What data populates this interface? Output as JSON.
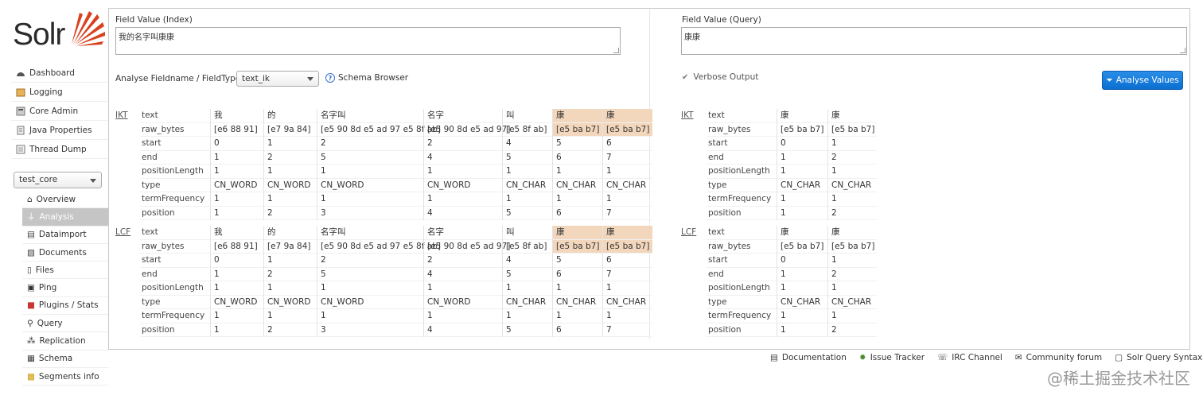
{
  "logo": {
    "text": "Solr"
  },
  "nav": [
    {
      "label": "Dashboard",
      "icon": "dashboard-icon"
    },
    {
      "label": "Logging",
      "icon": "logging-icon"
    },
    {
      "label": "Core Admin",
      "icon": "core-admin-icon"
    },
    {
      "label": "Java Properties",
      "icon": "java-properties-icon"
    },
    {
      "label": "Thread Dump",
      "icon": "thread-dump-icon"
    }
  ],
  "core_selector": {
    "value": "test_core"
  },
  "core_nav": [
    {
      "label": "Overview",
      "icon": "home-icon"
    },
    {
      "label": "Analysis",
      "icon": "filter-icon",
      "active": true
    },
    {
      "label": "Dataimport",
      "icon": "dataimport-icon"
    },
    {
      "label": "Documents",
      "icon": "documents-icon"
    },
    {
      "label": "Files",
      "icon": "files-icon"
    },
    {
      "label": "Ping",
      "icon": "ping-icon"
    },
    {
      "label": "Plugins / Stats",
      "icon": "plugins-icon"
    },
    {
      "label": "Query",
      "icon": "query-icon"
    },
    {
      "label": "Replication",
      "icon": "replication-icon"
    },
    {
      "label": "Schema",
      "icon": "schema-icon"
    },
    {
      "label": "Segments info",
      "icon": "segments-icon"
    }
  ],
  "analysis": {
    "index_label": "Field Value (Index)",
    "index_value": "我的名字叫康康",
    "query_label": "Field Value (Query)",
    "query_value": "康康",
    "fieldtype_label": "Analyse Fieldname / FieldType:",
    "fieldtype_value": "text_ik",
    "schema_browser": "Schema Browser",
    "verbose_label": "Verbose Output",
    "analyse_button": "Analyse Values"
  },
  "attributes": [
    "text",
    "raw_bytes",
    "start",
    "end",
    "positionLength",
    "type",
    "termFrequency",
    "position"
  ],
  "index_blocks": [
    {
      "label": "IKT",
      "tokens": [
        {
          "vals": [
            "我",
            "[e6 88 91]",
            "0",
            "1",
            "1",
            "CN_WORD",
            "1",
            "1"
          ]
        },
        {
          "vals": [
            "的",
            "[e7 9a 84]",
            "1",
            "2",
            "1",
            "CN_WORD",
            "1",
            "2"
          ]
        },
        {
          "vals": [
            "名字叫",
            "[e5 90 8d e5 ad 97 e5 8f ab]",
            "2",
            "5",
            "1",
            "CN_WORD",
            "1",
            "3"
          ]
        },
        {
          "vals": [
            "名字",
            "[e5 90 8d e5 ad 97]",
            "2",
            "4",
            "1",
            "CN_WORD",
            "1",
            "4"
          ]
        },
        {
          "vals": [
            "叫",
            "[e5 8f ab]",
            "4",
            "5",
            "1",
            "CN_CHAR",
            "1",
            "5"
          ]
        },
        {
          "vals": [
            "康",
            "[e5 ba b7]",
            "5",
            "6",
            "1",
            "CN_CHAR",
            "1",
            "6"
          ],
          "match": true
        },
        {
          "vals": [
            "康",
            "[e5 ba b7]",
            "6",
            "7",
            "1",
            "CN_CHAR",
            "1",
            "7"
          ],
          "match": true
        }
      ]
    },
    {
      "label": "LCF",
      "tokens": [
        {
          "vals": [
            "我",
            "[e6 88 91]",
            "0",
            "1",
            "1",
            "CN_WORD",
            "1",
            "1"
          ]
        },
        {
          "vals": [
            "的",
            "[e7 9a 84]",
            "1",
            "2",
            "1",
            "CN_WORD",
            "1",
            "2"
          ]
        },
        {
          "vals": [
            "名字叫",
            "[e5 90 8d e5 ad 97 e5 8f ab]",
            "2",
            "5",
            "1",
            "CN_WORD",
            "1",
            "3"
          ]
        },
        {
          "vals": [
            "名字",
            "[e5 90 8d e5 ad 97]",
            "2",
            "4",
            "1",
            "CN_WORD",
            "1",
            "4"
          ]
        },
        {
          "vals": [
            "叫",
            "[e5 8f ab]",
            "4",
            "5",
            "1",
            "CN_CHAR",
            "1",
            "5"
          ]
        },
        {
          "vals": [
            "康",
            "[e5 ba b7]",
            "5",
            "6",
            "1",
            "CN_CHAR",
            "1",
            "6"
          ],
          "match": true
        },
        {
          "vals": [
            "康",
            "[e5 ba b7]",
            "6",
            "7",
            "1",
            "CN_CHAR",
            "1",
            "7"
          ],
          "match": true
        }
      ]
    }
  ],
  "query_blocks": [
    {
      "label": "IKT",
      "tokens": [
        {
          "vals": [
            "康",
            "[e5 ba b7]",
            "0",
            "1",
            "1",
            "CN_CHAR",
            "1",
            "1"
          ]
        },
        {
          "vals": [
            "康",
            "[e5 ba b7]",
            "1",
            "2",
            "1",
            "CN_CHAR",
            "1",
            "2"
          ]
        }
      ]
    },
    {
      "label": "LCF",
      "tokens": [
        {
          "vals": [
            "康",
            "[e5 ba b7]",
            "0",
            "1",
            "1",
            "CN_CHAR",
            "1",
            "1"
          ]
        },
        {
          "vals": [
            "康",
            "[e5 ba b7]",
            "1",
            "2",
            "1",
            "CN_CHAR",
            "1",
            "2"
          ]
        }
      ]
    }
  ],
  "footer": [
    {
      "label": "Documentation",
      "icon": "documentation-icon"
    },
    {
      "label": "Issue Tracker",
      "icon": "bug-icon"
    },
    {
      "label": "IRC Channel",
      "icon": "irc-icon"
    },
    {
      "label": "Community forum",
      "icon": "mail-icon"
    },
    {
      "label": "Solr Query Syntax",
      "icon": "syntax-icon"
    }
  ],
  "watermark": "@稀土掘金技术社区",
  "colors": {
    "accent": "#0b6fd0",
    "match_highlight": "#f3d7bd",
    "logo_red": "#d9411e"
  }
}
